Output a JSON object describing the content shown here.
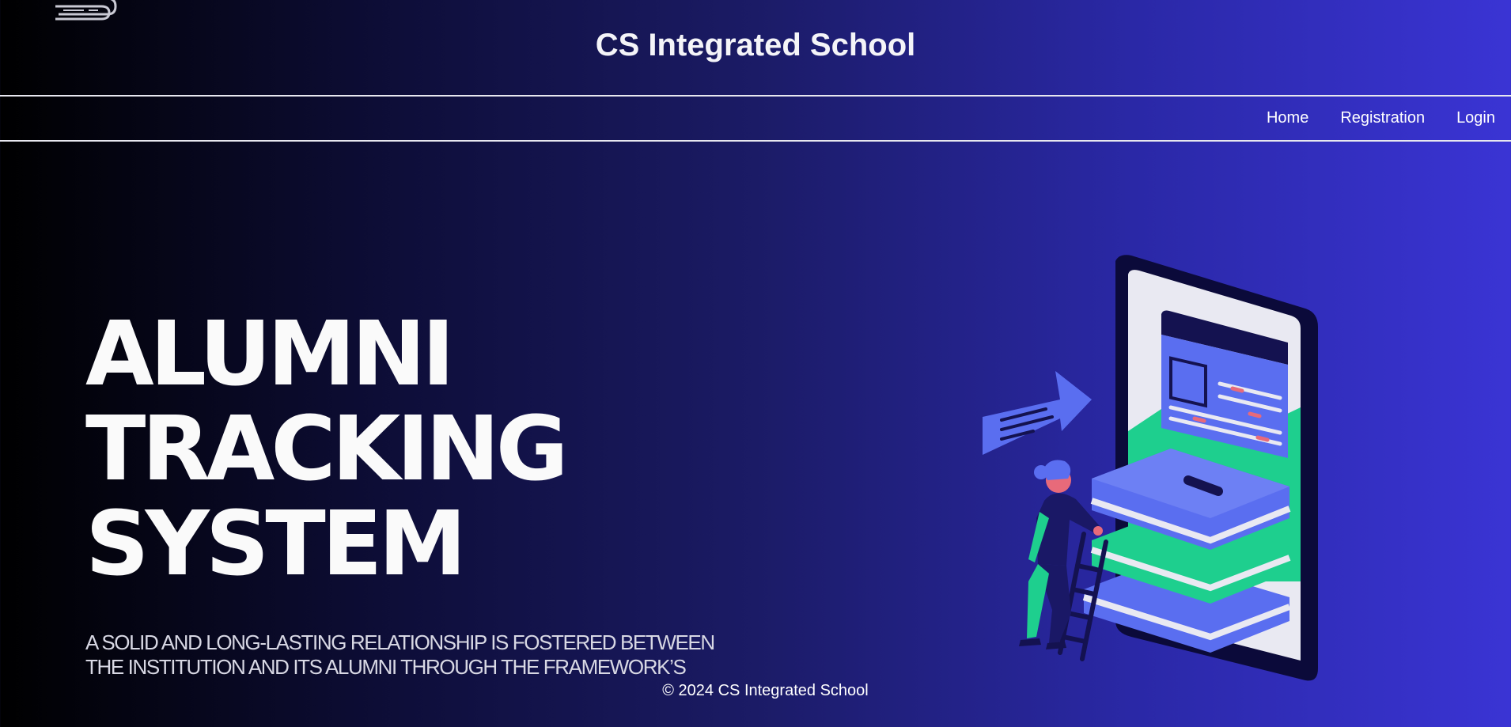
{
  "header": {
    "title": "CS Integrated School",
    "logo_icon": "book-stack-icon"
  },
  "nav": {
    "items": [
      {
        "label": "Home"
      },
      {
        "label": "Registration"
      },
      {
        "label": "Login"
      }
    ]
  },
  "hero": {
    "title_lines": [
      "ALUMNI",
      "TRACKING",
      "SYSTEM"
    ],
    "subtitle_lines": [
      "A SOLID AND LONG-LASTING RELATIONSHIP IS FOSTERED BETWEEN",
      "THE INSTITUTION AND ITS ALUMNI THROUGH THE FRAMEWORK’S"
    ],
    "illustration_icon": "phone-books-ladder-illustration"
  },
  "footer": {
    "text": "© 2024 CS Integrated School"
  },
  "colors": {
    "gradient_start": "#000000",
    "gradient_end": "#3a34d4",
    "text": "#ffffff"
  }
}
